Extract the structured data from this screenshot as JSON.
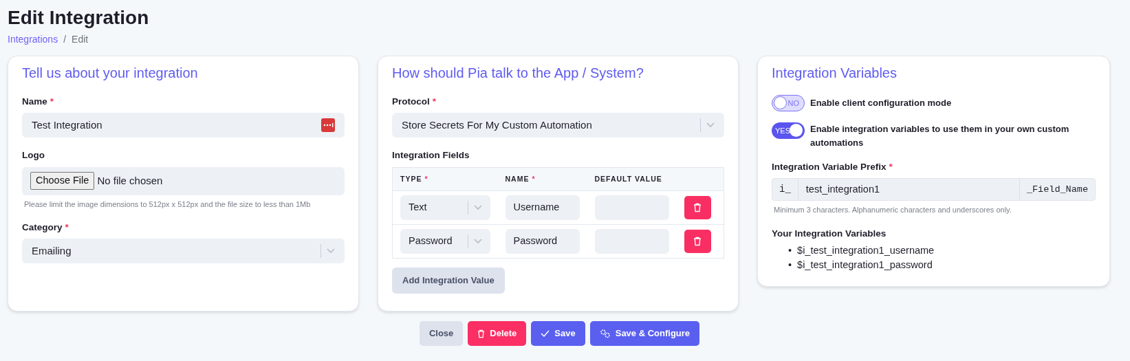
{
  "page": {
    "title": "Edit Integration",
    "separator": "/",
    "breadcrumb": [
      {
        "label": "Integrations",
        "kind": "link"
      },
      {
        "label": "Edit",
        "kind": "current"
      }
    ]
  },
  "about_card": {
    "title": "Tell us about your integration",
    "fields": [
      {
        "kind": "text",
        "label": "Name",
        "required_mark": "*",
        "value": "Test Integration"
      },
      {
        "kind": "file",
        "label": "Logo",
        "button": "Choose File",
        "value": "No file chosen",
        "help": "Please limit the image dimensions to 512px x 512px and the file size to less than 1Mb"
      },
      {
        "kind": "select",
        "label": "Category",
        "required_mark": "*",
        "value": "Emailing"
      }
    ]
  },
  "protocol_card": {
    "title": "How should Pia talk to the App / System?",
    "protocol": {
      "label": "Protocol",
      "required_mark": "*",
      "value": "Store Secrets For My Custom Automation"
    },
    "fields_label": "Integration Fields",
    "table": {
      "columns": [
        {
          "label": "TYPE",
          "required_mark": "*"
        },
        {
          "label": "NAME",
          "required_mark": "*"
        },
        {
          "label": "DEFAULT VALUE"
        }
      ],
      "rows": [
        {
          "type": "Text",
          "name": "Username"
        },
        {
          "type": "Password",
          "name": "Password"
        }
      ]
    },
    "add_button": "Add Integration Value"
  },
  "variables_card": {
    "title": "Integration Variables",
    "toggles": [
      {
        "on": false,
        "state_text": "NO",
        "label": "Enable client configuration mode"
      },
      {
        "on": true,
        "state_text": "YES",
        "label": "Enable integration variables to use them in your own custom automations"
      }
    ],
    "prefix": {
      "label": "Integration Variable Prefix",
      "required_mark": "*",
      "prefix": "i_",
      "value": "test_integration1",
      "suffix": "_Field_Name",
      "help": "Minimum 3 characters. Alphanumeric characters and underscores only."
    },
    "list_title": "Your Integration Variables",
    "bullet": "•",
    "variables": [
      "$i_test_integration1_username",
      "$i_test_integration1_password"
    ]
  },
  "actions": [
    {
      "label": "Close",
      "kind": "secondary"
    },
    {
      "label": "Delete",
      "kind": "danger"
    },
    {
      "label": "Save",
      "kind": "primary"
    },
    {
      "label": "Save & Configure",
      "kind": "primary"
    }
  ]
}
